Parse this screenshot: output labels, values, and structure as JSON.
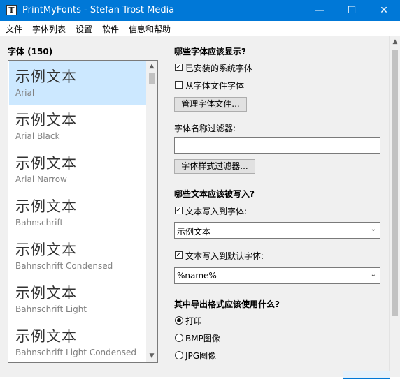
{
  "window": {
    "title": "PrintMyFonts - Stefan Trost Media",
    "app_icon_glyph": "T",
    "controls": {
      "minimize": "—",
      "maximize": "☐",
      "close": "✕"
    }
  },
  "menu": [
    "文件",
    "字体列表",
    "设置",
    "软件",
    "信息和帮助"
  ],
  "font_panel": {
    "header": "字体 (150)",
    "sample_text": "示例文本",
    "items": [
      {
        "name": "Arial",
        "selected": true
      },
      {
        "name": "Arial Black"
      },
      {
        "name": "Arial Narrow"
      },
      {
        "name": "Bahnschrift"
      },
      {
        "name": "Bahnschrift Condensed"
      },
      {
        "name": "Bahnschrift Light"
      },
      {
        "name": "Bahnschrift Light Condensed"
      }
    ]
  },
  "options": {
    "which_fonts_heading": "哪些字体应该显示?",
    "installed_label": "已安装的系统字体",
    "installed_checked": true,
    "from_file_label": "从字体文件字体",
    "from_file_checked": false,
    "manage_button": "管理字体文件...",
    "name_filter_label": "字体名称过滤器:",
    "name_filter_value": "",
    "style_filter_button": "字体样式过滤器...",
    "which_text_heading": "哪些文本应该被写入?",
    "write_text_label": "文本写入到字体:",
    "write_text_checked": true,
    "write_text_value": "示例文本",
    "write_default_label": "文本写入到默认字体:",
    "write_default_checked": true,
    "write_default_value": "%name%",
    "export_heading": "其中导出格式应该使用什么?",
    "formats": [
      {
        "label": "打印",
        "selected": true
      },
      {
        "label": "BMP图像",
        "selected": false
      },
      {
        "label": "JPG图像",
        "selected": false
      }
    ]
  },
  "icons": {
    "check": "✓",
    "chevron_down": "⌄",
    "scroll_up": "▲",
    "scroll_down": "▼"
  }
}
